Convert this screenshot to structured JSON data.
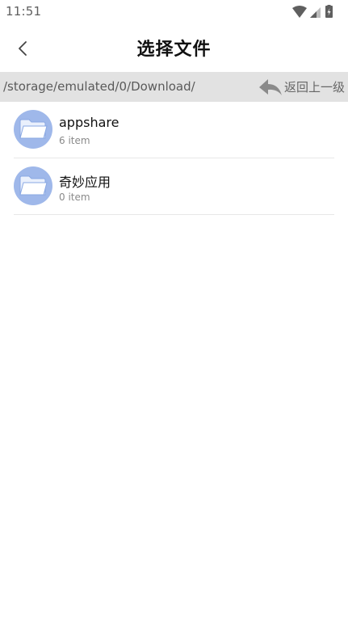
{
  "status_bar": {
    "time": "11:51",
    "icons": [
      "wifi-icon",
      "signal-icon",
      "battery-icon"
    ]
  },
  "header": {
    "title": "选择文件",
    "back_icon": "chevron-left-icon"
  },
  "path_bar": {
    "path": "/storage/emulated/0/Download/",
    "up_label": "返回上一级",
    "up_icon": "reply-arrow-icon"
  },
  "files": [
    {
      "name": "appshare",
      "count": "6 item",
      "icon": "folder-icon"
    },
    {
      "name": "奇妙应用",
      "count": "0 item",
      "icon": "folder-icon"
    }
  ],
  "colors": {
    "path_bar_bg": "#e2e2e2",
    "folder_circle": "#9fb8ea",
    "divider": "#e8e8e8"
  }
}
